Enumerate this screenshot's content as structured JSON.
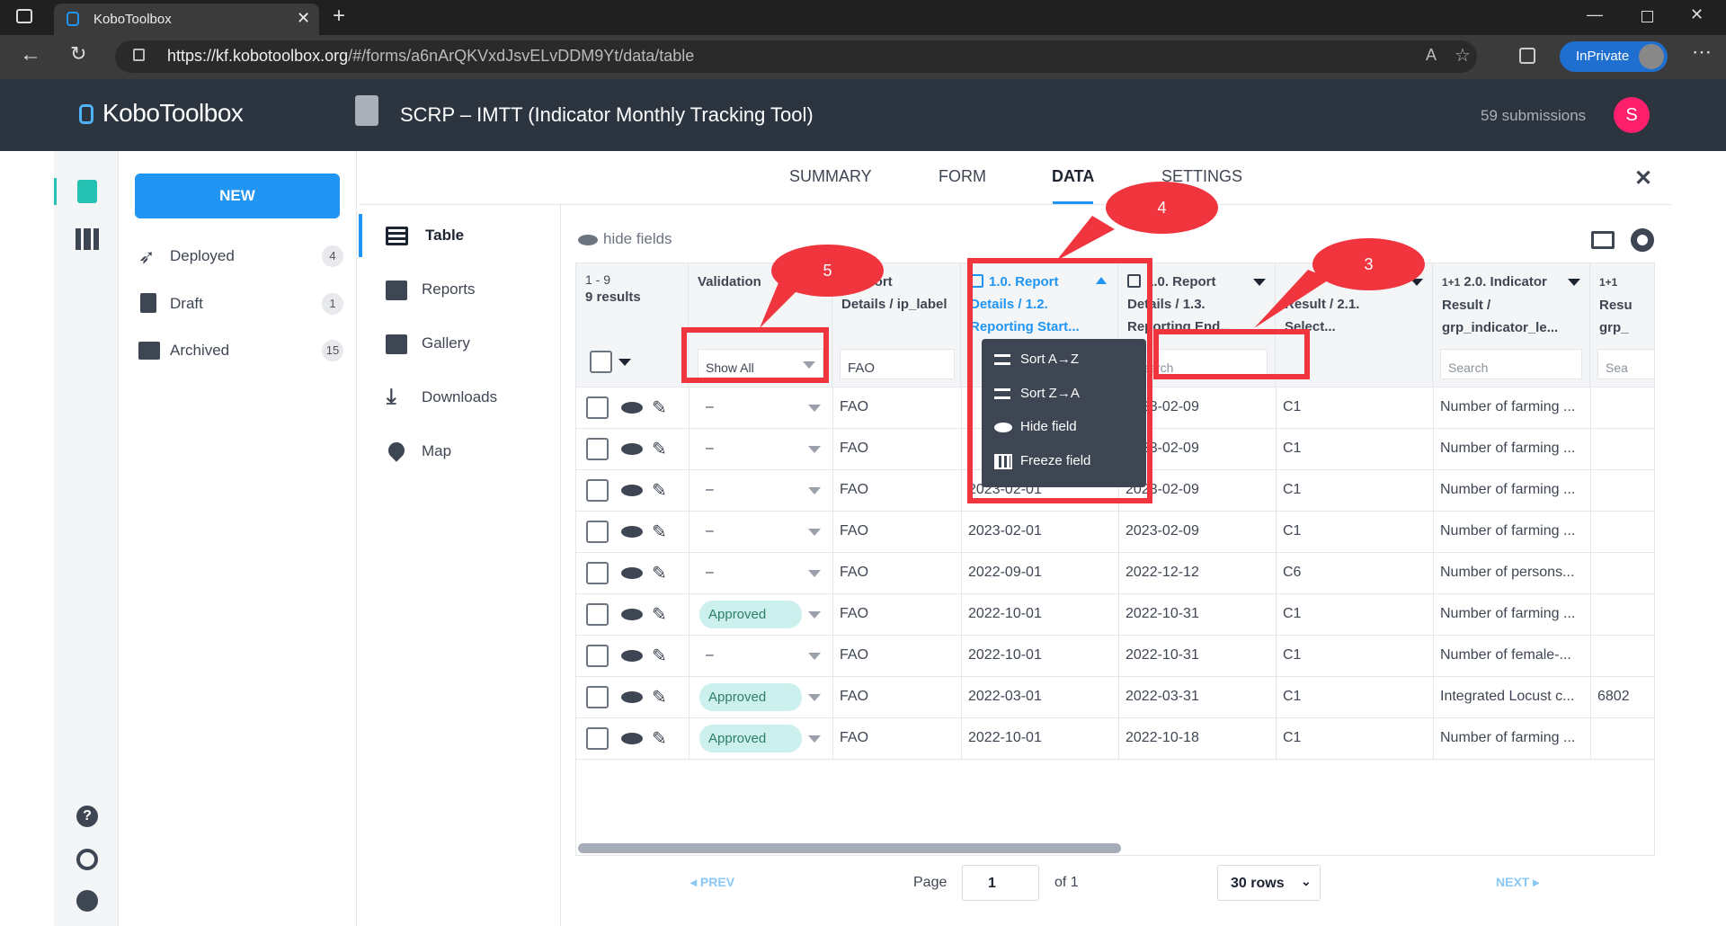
{
  "browser": {
    "tab_title": "KoboToolbox",
    "url_host": "https://kf.kobotoolbox.org",
    "url_path": "/#/forms/a6nArQKVxdJsvELvDDM9Yt/data/table",
    "inprivate_label": "InPrivate"
  },
  "header": {
    "logo_text": "KoboToolbox",
    "form_title": "SCRP – IMTT (Indicator Monthly Tracking Tool)",
    "submissions": "59 submissions",
    "avatar_letter": "S"
  },
  "sidebar": {
    "new_label": "NEW",
    "items": [
      {
        "label": "Deployed",
        "count": "4"
      },
      {
        "label": "Draft",
        "count": "1"
      },
      {
        "label": "Archived",
        "count": "15"
      }
    ]
  },
  "nav": {
    "tabs": [
      "SUMMARY",
      "FORM",
      "DATA",
      "SETTINGS"
    ],
    "active": "DATA"
  },
  "subnav": {
    "items": [
      "Table",
      "Reports",
      "Gallery",
      "Downloads",
      "Map"
    ],
    "active": "Table"
  },
  "table": {
    "hide_fields_label": "hide fields",
    "range": "1 - 9",
    "results": "9 results",
    "headers": {
      "validation": "Validation",
      "report_label_1": ". Report",
      "report_label_2": "Details / ip_label",
      "start_1": "1.0. Report",
      "start_2": "Details / 1.2.",
      "start_3": "Reporting Start...",
      "end_1": "1.0. Report",
      "end_2": "Details / 1.3.",
      "end_3": "Reporting End...",
      "result_1": "Result / 2.1.",
      "result_2": "Select...",
      "indicator_1": "2.0. Indicator",
      "indicator_2": "Result /",
      "indicator_3": "grp_indicator_le...",
      "next_1": "Resu",
      "next_2": "grp_"
    },
    "filters": {
      "validation": "Show All",
      "ip_label": "FAO",
      "end_placeholder": "Search",
      "indicator_placeholder": "Search",
      "next_placeholder": "Sea"
    },
    "rows": [
      {
        "validation": "–",
        "ip": "FAO",
        "start": "",
        "end": "2023-02-09",
        "select": "C1",
        "indicator": "Number of farming ...",
        "next": ""
      },
      {
        "validation": "–",
        "ip": "FAO",
        "start": "",
        "end": "2023-02-09",
        "select": "C1",
        "indicator": "Number of farming ...",
        "next": ""
      },
      {
        "validation": "–",
        "ip": "FAO",
        "start": "2023-02-01",
        "end": "2023-02-09",
        "select": "C1",
        "indicator": "Number of farming ...",
        "next": ""
      },
      {
        "validation": "–",
        "ip": "FAO",
        "start": "2023-02-01",
        "end": "2023-02-09",
        "select": "C1",
        "indicator": "Number of farming ...",
        "next": ""
      },
      {
        "validation": "–",
        "ip": "FAO",
        "start": "2022-09-01",
        "end": "2022-12-12",
        "select": "C6",
        "indicator": "Number of persons...",
        "next": ""
      },
      {
        "validation": "Approved",
        "ip": "FAO",
        "start": "2022-10-01",
        "end": "2022-10-31",
        "select": "C1",
        "indicator": "Number of farming ...",
        "next": ""
      },
      {
        "validation": "–",
        "ip": "FAO",
        "start": "2022-10-01",
        "end": "2022-10-31",
        "select": "C1",
        "indicator": "Number of female-...",
        "next": ""
      },
      {
        "validation": "Approved",
        "ip": "FAO",
        "start": "2022-03-01",
        "end": "2022-03-31",
        "select": "C1",
        "indicator": "Integrated Locust c...",
        "next": "6802"
      },
      {
        "validation": "Approved",
        "ip": "FAO",
        "start": "2022-10-01",
        "end": "2022-10-18",
        "select": "C1",
        "indicator": "Number of farming ...",
        "next": ""
      }
    ]
  },
  "column_menu": {
    "items": [
      "Sort A→Z",
      "Sort Z→A",
      "Hide field",
      "Freeze field"
    ]
  },
  "annotations": {
    "labels": [
      "5",
      "4",
      "3"
    ]
  },
  "pager": {
    "prev": "PREV",
    "page_label": "Page",
    "page_value": "1",
    "of_label": "of 1",
    "rows_label": "30 rows",
    "next": "NEXT"
  },
  "colors": {
    "accent": "#2095f3",
    "header_bg": "#2c3440",
    "annotation_red": "#f0353e",
    "approved_bg": "#ccf0ed"
  }
}
